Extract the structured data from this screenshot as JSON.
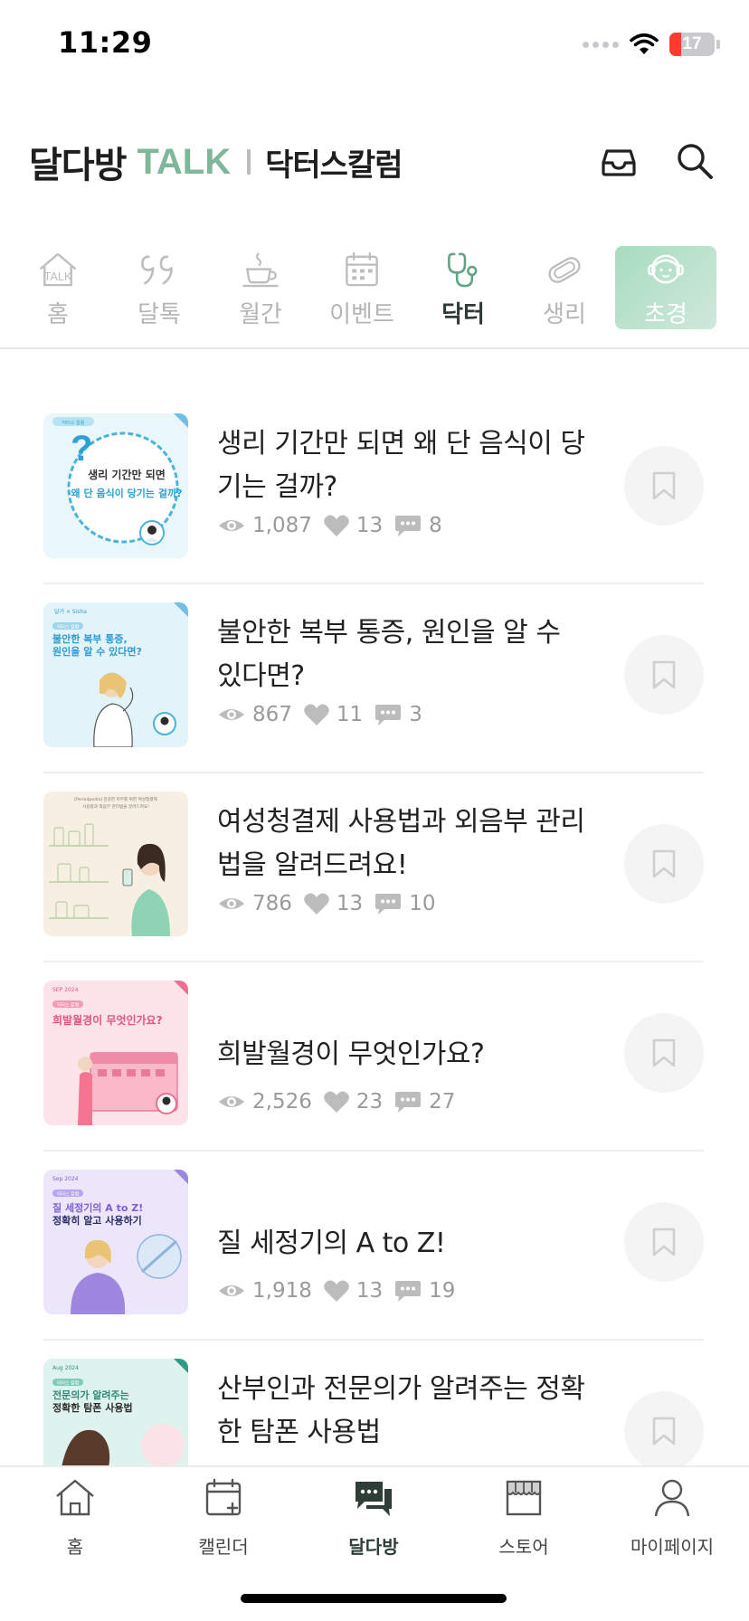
{
  "status_bar": {
    "time": "11:29",
    "battery": "17",
    "battery_color": "#ff3b30"
  },
  "header": {
    "brand_name": "달다방",
    "brand_talk": "TALK",
    "section_title": "닥터스칼럼",
    "inbox_icon": "inbox-icon",
    "search_icon": "search-icon",
    "accent_color": "#7fb79a"
  },
  "categories": [
    {
      "label": "홈",
      "icon": "home-talk-icon"
    },
    {
      "label": "달톡",
      "icon": "quote-icon"
    },
    {
      "label": "월간",
      "icon": "coffee-cup-icon"
    },
    {
      "label": "이벤트",
      "icon": "calendar-icon"
    },
    {
      "label": "닥터",
      "icon": "stethoscope-icon",
      "state": "selected"
    },
    {
      "label": "생리",
      "icon": "pad-icon"
    },
    {
      "label": "초경",
      "icon": "girl-face-icon",
      "state": "highlighted"
    }
  ],
  "articles": [
    {
      "title": "생리 기간만 되면 왜 단 음식이 당기는 걸까?",
      "views": "1,087",
      "likes": "13",
      "comments": "8",
      "thumb": {
        "line1": "생리 기간만 되면",
        "line2": "왜 단 음식이 당기는 걸까?",
        "tag": "닥터스 칼럼"
      }
    },
    {
      "title": "불안한 복부 통증, 원인을 알 수 있다면?",
      "views": "867",
      "likes": "11",
      "comments": "3",
      "thumb": {
        "top": "달거 × Sisha",
        "tag": "닥터스 칼럼",
        "line1": "불안한 복부 통증,",
        "line2": "원인을 알 수 있다면?"
      }
    },
    {
      "title": "여성청결제 사용법과 외음부 관리법을 알려드려요!",
      "views": "786",
      "likes": "13",
      "comments": "10",
      "thumb": {
        "line1": "[Periodpedia] 민감한 피부를 위한 여성청결제",
        "line2": "사용법과 외음부 관리법을 알려드려요!"
      }
    },
    {
      "title": "희발월경이 무엇인가요?",
      "views": "2,526",
      "likes": "23",
      "comments": "27",
      "thumb": {
        "top": "SEP 2024",
        "tag": "닥터스 칼럼",
        "line1": "희발월경이 무엇인가요?"
      }
    },
    {
      "title": "질 세정기의 A to Z!",
      "views": "1,918",
      "likes": "13",
      "comments": "19",
      "thumb": {
        "top": "Sep 2024",
        "tag": "닥터스 칼럼",
        "line1": "질 세정기의 A to Z!",
        "line2": "정확히 알고 사용하기"
      }
    },
    {
      "title": "산부인과 전문의가 알려주는 정확한 탐폰 사용법",
      "thumb": {
        "top": "Aug 2024",
        "tag": "닥터스 칼럼",
        "line1": "전문의가 알려주는",
        "line2": "정확한 탐폰 사용법"
      }
    }
  ],
  "bottom_nav": [
    {
      "label": "홈",
      "icon": "house-icon"
    },
    {
      "label": "캘린더",
      "icon": "calendar-plus-icon"
    },
    {
      "label": "달다방",
      "icon": "chat-bubbles-icon",
      "state": "active"
    },
    {
      "label": "스토어",
      "icon": "storefront-icon"
    },
    {
      "label": "마이페이지",
      "icon": "person-icon"
    }
  ]
}
